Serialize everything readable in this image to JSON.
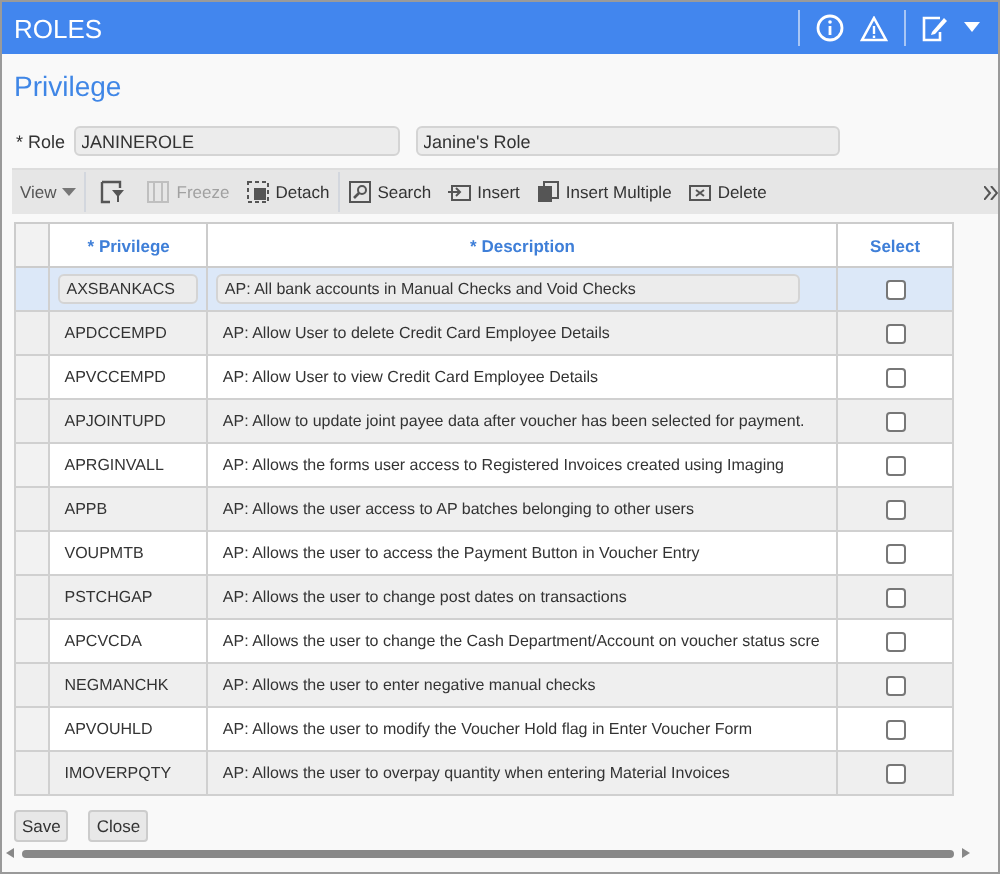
{
  "window": {
    "title": "ROLES"
  },
  "section_title": "Privilege",
  "role": {
    "label": "* Role",
    "code": "JANINEROLE",
    "name": "Janine's Role"
  },
  "toolbar": [
    {
      "kind": "menu",
      "label": "View"
    },
    {
      "kind": "icon"
    },
    {
      "kind": "button",
      "label": "Freeze",
      "disabled": true
    },
    {
      "kind": "button",
      "label": "Detach",
      "disabled": false
    },
    {
      "kind": "button",
      "label": "Search",
      "disabled": false
    },
    {
      "kind": "button",
      "label": "Insert",
      "disabled": false
    },
    {
      "kind": "button",
      "label": "Insert Multiple",
      "disabled": false
    },
    {
      "kind": "button",
      "label": "Delete",
      "disabled": false
    }
  ],
  "table": {
    "columns": [
      "* Privilege",
      "* Description",
      "Select"
    ],
    "rows": [
      {
        "privilege": "AXSBANKACS",
        "description": "AP: All bank accounts in Manual Checks and Void Checks",
        "checked": false,
        "selected": true
      },
      {
        "privilege": "APDCCEMPD",
        "description": "AP: Allow User to delete Credit Card Employee Details",
        "checked": false,
        "selected": false
      },
      {
        "privilege": "APVCCEMPD",
        "description": "AP: Allow User to view Credit Card Employee Details",
        "checked": false,
        "selected": false
      },
      {
        "privilege": "APJOINTUPD",
        "description": "AP: Allow to update joint payee data after voucher has been selected for payment.",
        "checked": false,
        "selected": false
      },
      {
        "privilege": "APRGINVALL",
        "description": "AP: Allows the forms user access to Registered Invoices created using Imaging",
        "checked": false,
        "selected": false
      },
      {
        "privilege": "APPB",
        "description": "AP: Allows the user access to AP batches belonging to other users",
        "checked": false,
        "selected": false
      },
      {
        "privilege": "VOUPMTB",
        "description": "AP: Allows the user to access the Payment Button in Voucher Entry",
        "checked": false,
        "selected": false
      },
      {
        "privilege": "PSTCHGAP",
        "description": "AP: Allows the user to change post dates on transactions",
        "checked": false,
        "selected": false
      },
      {
        "privilege": "APCVCDA",
        "description": "AP: Allows the user to change the Cash Department/Account on voucher status scre",
        "checked": false,
        "selected": false
      },
      {
        "privilege": "NEGMANCHK",
        "description": "AP: Allows the user to enter negative manual checks",
        "checked": false,
        "selected": false
      },
      {
        "privilege": "APVOUHLD",
        "description": "AP: Allows the user to modify the Voucher Hold flag in Enter Voucher Form",
        "checked": false,
        "selected": false
      },
      {
        "privilege": "IMOVERPQTY",
        "description": "AP: Allows the user to overpay quantity when entering Material Invoices",
        "checked": false,
        "selected": false
      }
    ]
  },
  "buttons": [
    "Save",
    "Close"
  ]
}
